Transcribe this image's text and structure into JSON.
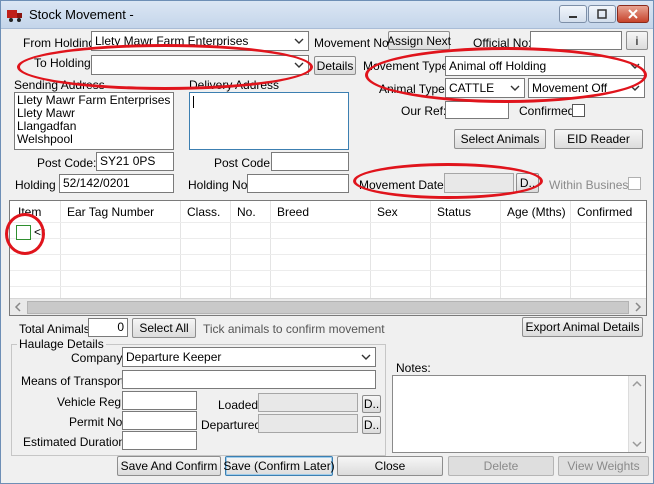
{
  "window": {
    "title": "Stock Movement -"
  },
  "header": {
    "from_holding_label": "From Holding:",
    "from_holding_value": "Llety Mawr Farm Enterprises",
    "movement_no_label": "Movement No:",
    "assign_next_label": "Assign Next",
    "official_no_label": "Official No:",
    "official_no_value": "",
    "info_button_label": "i",
    "to_holding_label": "To Holding:",
    "to_holding_value": "",
    "details_button_label": "Details",
    "movement_type_label": "Movement Type:",
    "movement_type_value": "Animal off Holding",
    "animal_type_label": "Animal Type:",
    "animal_type_value": "CATTLE",
    "movement_direction_value": "Movement Off",
    "our_ref_label": "Our Ref:",
    "our_ref_value": "",
    "confirmed_label": "Confirmed:",
    "select_animals_label": "Select Animals",
    "eid_reader_label": "EID Reader"
  },
  "sending": {
    "label": "Sending Address",
    "lines": [
      "Llety Mawr Farm Enterprises",
      "Llety Mawr",
      "Llangadfan",
      "Welshpool"
    ],
    "post_code_label": "Post Code:",
    "post_code_value": "SY21 0PS",
    "holding_no_label": "Holding No:",
    "holding_no_value": "52/142/0201"
  },
  "delivery": {
    "label": "Delivery Address",
    "value": "",
    "post_code_label": "Post Code:",
    "post_code_value": "",
    "holding_no_label": "Holding No:",
    "holding_no_value": ""
  },
  "movement_date": {
    "label": "Movement Date:",
    "value": "",
    "picker_label": "D..",
    "within_business_label": "Within Business"
  },
  "grid": {
    "columns": [
      "Item",
      "Ear Tag Number",
      "Class.",
      "No.",
      "Breed",
      "Sex",
      "Status",
      "Age (Mths)",
      "Confirmed"
    ],
    "row_text": "<r"
  },
  "totals": {
    "total_label": "Total Animals:",
    "total_value": "0",
    "select_all_label": "Select All",
    "hint": "Tick animals to confirm movement",
    "export_label": "Export Animal Details"
  },
  "haulage": {
    "group_label": "Haulage Details",
    "company_label": "Company:",
    "company_value": "Departure Keeper",
    "transport_label": "Means of Transport:",
    "transport_value": "",
    "vehicle_label": "Vehicle Reg:",
    "vehicle_value": "",
    "permit_label": "Permit No:",
    "permit_value": "",
    "duration_label": "Estimated Duration:",
    "duration_value": "",
    "loaded_label": "Loaded:",
    "loaded_value": "",
    "departured_label": "Departured:",
    "departured_value": "",
    "picker_label": "D.."
  },
  "notes": {
    "label": "Notes:",
    "value": ""
  },
  "footer": {
    "save_confirm": "Save And Confirm",
    "save_later": "Save (Confirm Later)",
    "close": "Close",
    "delete": "Delete",
    "view_weights": "View Weights"
  },
  "colors": {
    "annotation": "#e0141c",
    "window_bg": "#f0f0f0"
  }
}
